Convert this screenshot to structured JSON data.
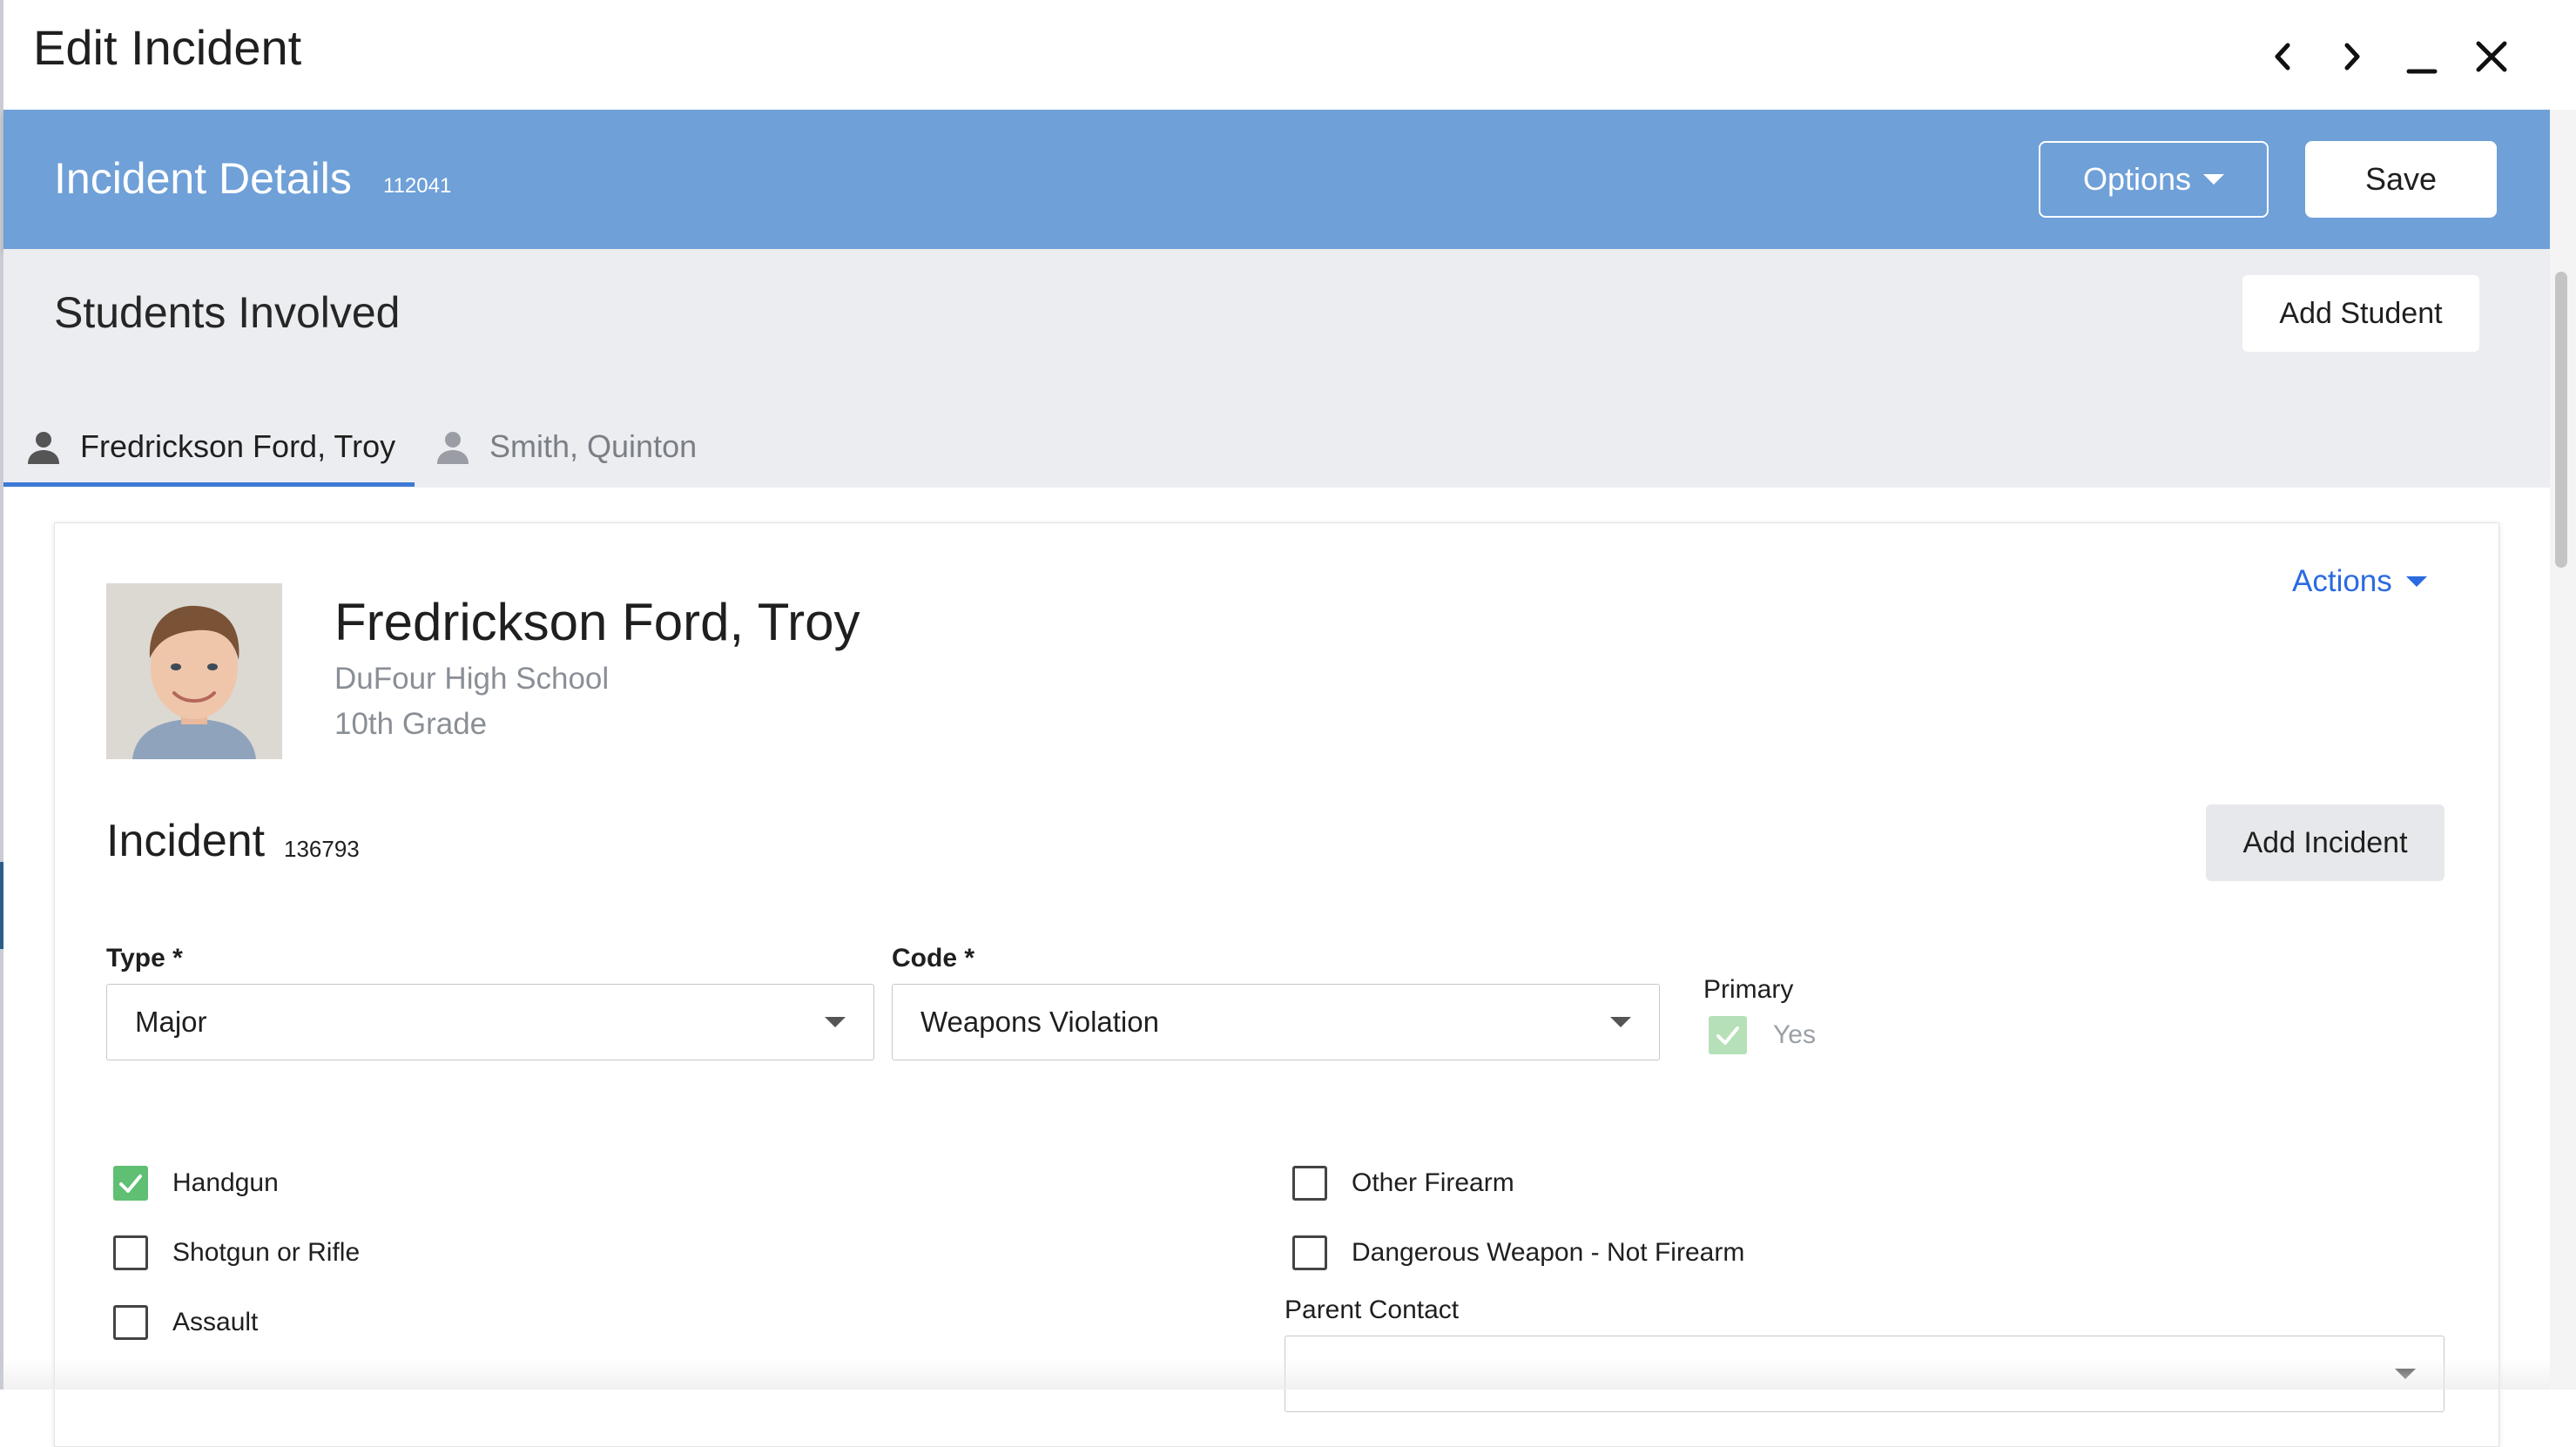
{
  "window": {
    "title": "Edit Incident"
  },
  "header": {
    "title": "Incident Details",
    "id": "112041",
    "options_label": "Options",
    "save_label": "Save",
    "color": "#6fa0d8"
  },
  "students_section": {
    "title": "Students Involved",
    "add_student_label": "Add Student",
    "tabs": [
      {
        "label": "Fredrickson Ford, Troy",
        "active": true
      },
      {
        "label": "Smith, Quinton",
        "active": false
      }
    ]
  },
  "student": {
    "name": "Fredrickson Ford, Troy",
    "school": "DuFour High School",
    "grade": "10th Grade",
    "actions_label": "Actions"
  },
  "incident": {
    "title": "Incident",
    "id": "136793",
    "add_incident_label": "Add Incident",
    "type_label": "Type *",
    "type_value": "Major",
    "code_label": "Code *",
    "code_value": "Weapons Violation",
    "primary_label": "Primary",
    "primary_value": "Yes",
    "primary_checked": true,
    "options": [
      {
        "label": "Handgun",
        "checked": true
      },
      {
        "label": "Shotgun or Rifle",
        "checked": false
      },
      {
        "label": "Assault",
        "checked": false
      },
      {
        "label": "Other Firearm",
        "checked": false
      },
      {
        "label": "Dangerous Weapon - Not Firearm",
        "checked": false
      }
    ],
    "parent_contact_label": "Parent Contact",
    "parent_contact_value": ""
  },
  "colors": {
    "accent_link": "#2a6be0",
    "tab_underline": "#3d7ad6",
    "checkbox_checked": "#5fbf72"
  }
}
